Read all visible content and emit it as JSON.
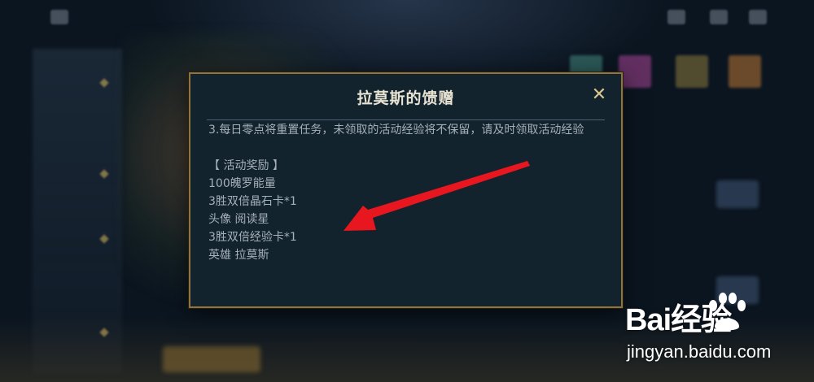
{
  "dialog": {
    "title": "拉莫斯的馈赠",
    "close_symbol": "✕",
    "rule_line": "3.每日零点将重置任务，未领取的活动经验将不保留，请及时领取活动经验",
    "reward_header": "【 活动奖励 】",
    "rewards": [
      "100魄罗能量",
      "3胜双倍晶石卡*1",
      "头像 阅读星",
      "3胜双倍经验卡*1",
      "英雄 拉莫斯"
    ]
  },
  "annotation": {
    "arrow_color": "#e8161e"
  },
  "watermark": {
    "logo": "Bai经验",
    "url": "jingyan.baidu.com"
  },
  "colors": {
    "dialog_bg": "#12232e",
    "dialog_border": "#8d7440",
    "title": "#e8e2d2",
    "text": "#a6b0b8"
  }
}
